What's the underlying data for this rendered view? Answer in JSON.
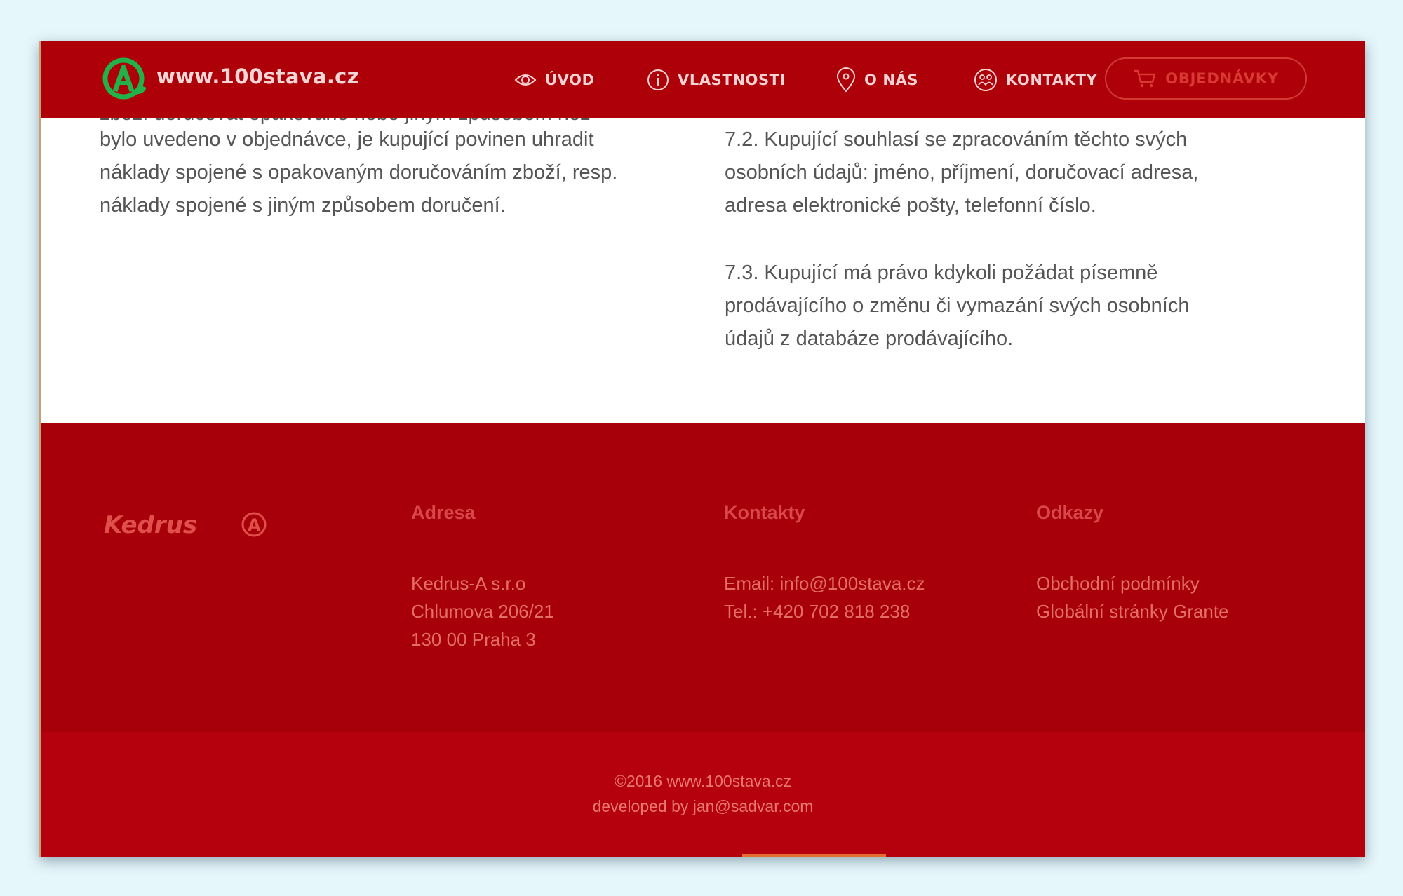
{
  "header": {
    "site_name": "www.100stava.cz",
    "nav": [
      {
        "label": "ÚVOD",
        "icon": "eye-icon"
      },
      {
        "label": "VLASTNOSTI",
        "icon": "info-icon"
      },
      {
        "label": "O NÁS",
        "icon": "map-pin-icon"
      },
      {
        "label": "KONTAKTY",
        "icon": "people-icon"
      }
    ],
    "orders_label": "OBJEDNÁVKY",
    "orders_icon": "cart-icon"
  },
  "content": {
    "left_cut_line": "zboží doručovat opakovaně nebo jiným způsobem než",
    "left_paragraph": "bylo uvedeno v objednávce, je kupující povinen uhradit\nnáklady spojené s opakovaným doručováním zboží, resp.\nnáklady spojené s jiným způsobem doručení.",
    "right_paragraph_1": "7.2. Kupující souhlasí se zpracováním těchto svých\nosobních údajů: jméno, příjmení, doručovací adresa,\nadresa elektronické pošty, telefonní číslo.",
    "right_paragraph_2": "7.3. Kupující má právo kdykoli požádat písemně\nprodávajícího o změnu či vymazání svých osobních\núdajů z databáze prodávajícího."
  },
  "footer": {
    "brand": "Kedrus",
    "address": {
      "heading": "Adresa",
      "lines": [
        "Kedrus-A s.r.o",
        "Chlumova 206/21",
        "130 00 Praha 3"
      ]
    },
    "contacts": {
      "heading": "Kontakty",
      "email": "Email: info@100stava.cz",
      "phone": "Tel.: +420 702 818 238"
    },
    "links": {
      "heading": "Odkazy",
      "items": [
        "Obchodní podmínky",
        "Globální stránky Grante"
      ]
    },
    "copyright": "©2016 www.100stava.cz",
    "developed_by": "developed by jan@sadvar.com"
  },
  "colors": {
    "header_bg": "#ad0009",
    "footer_bg": "#a8000a",
    "bottom_bg": "#b5000d",
    "logo_green": "#22b24a",
    "accent": "#d83a32"
  }
}
